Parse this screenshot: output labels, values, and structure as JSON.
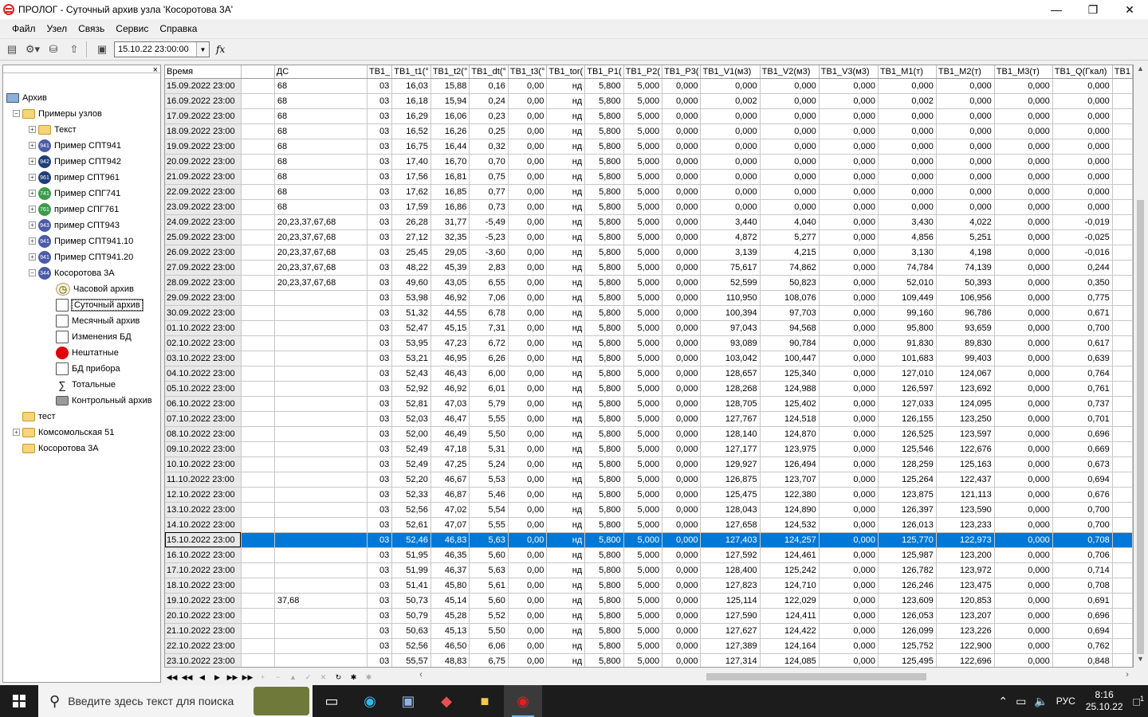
{
  "window": {
    "title": "ПРОЛОГ - Суточный архив узла 'Косоротова 3А'"
  },
  "menu": [
    "Файл",
    "Узел",
    "Связь",
    "Сервис",
    "Справка"
  ],
  "toolbar": {
    "date_value": "15.10.22 23:00:00",
    "fx_label": "fx"
  },
  "tree": [
    {
      "label": "Архив",
      "icon": "pc",
      "level": 0
    },
    {
      "label": "Примеры узлов",
      "icon": "folder",
      "level": 1,
      "exp": "-"
    },
    {
      "label": "Текст",
      "icon": "folder",
      "level": 2,
      "exp": "+"
    },
    {
      "label": "Пример СПТ941",
      "icon": "dev",
      "badge": "941",
      "level": 2,
      "exp": "+"
    },
    {
      "label": "Пример СПТ942",
      "icon": "devb",
      "badge": "942",
      "level": 2,
      "exp": "+"
    },
    {
      "label": "пример СПТ961",
      "icon": "devb",
      "badge": "961",
      "level": 2,
      "exp": "+"
    },
    {
      "label": "Пример СПГ741",
      "icon": "devg",
      "badge": "741",
      "level": 2,
      "exp": "+"
    },
    {
      "label": "пример СПГ761",
      "icon": "devg",
      "badge": "761",
      "level": 2,
      "exp": "+"
    },
    {
      "label": "пример СПТ943",
      "icon": "dev",
      "badge": "943",
      "level": 2,
      "exp": "+"
    },
    {
      "label": "Пример СПТ941.10",
      "icon": "dev",
      "badge": "941",
      "level": 2,
      "exp": "+"
    },
    {
      "label": "Пример СПТ941.20",
      "icon": "dev",
      "badge": "941",
      "level": 2,
      "exp": "+"
    },
    {
      "label": "Косоротова 3А",
      "icon": "dev",
      "badge": "344",
      "level": 2,
      "exp": "-"
    },
    {
      "label": "Часовой архив",
      "icon": "clock",
      "level": 3
    },
    {
      "label": "Суточный архив",
      "icon": "doc",
      "level": 3,
      "selected": true
    },
    {
      "label": "Месячный архив",
      "icon": "doc",
      "level": 3
    },
    {
      "label": "Изменения БД",
      "icon": "doc",
      "level": 3
    },
    {
      "label": "Нештатные",
      "icon": "red",
      "level": 3
    },
    {
      "label": "БД прибора",
      "icon": "doc",
      "level": 3
    },
    {
      "label": "Тотальные",
      "icon": "sum",
      "level": 3
    },
    {
      "label": "Контрольный архив",
      "icon": "chip",
      "level": 3
    },
    {
      "label": "тест",
      "icon": "folder",
      "level": 1
    },
    {
      "label": "Комсомольская 51",
      "icon": "folder",
      "level": 1,
      "exp": "+"
    },
    {
      "label": "Косоротова 3А",
      "icon": "folder",
      "level": 1
    }
  ],
  "table": {
    "columns": [
      "Время",
      "",
      "ДС",
      "ТВ1_",
      "ТВ1_t1(°",
      "ТВ1_t2(°",
      "ТВ1_dt(°",
      "ТВ1_t3(°",
      "ТВ1_tor(",
      "ТВ1_P1(",
      "ТВ1_P2(",
      "ТВ1_P3(",
      "ТВ1_V1(м3)",
      "ТВ1_V2(м3)",
      "ТВ1_V3(м3)",
      "ТВ1_M1(т)",
      "ТВ1_M2(т)",
      "ТВ1_M3(т)",
      "ТВ1_Q(Гкал)",
      "ТВ1"
    ],
    "selected_index": 30,
    "rows": [
      [
        "15.09.2022 23:00",
        "",
        "68",
        "03",
        "16,03",
        "15,88",
        "0,16",
        "0,00",
        "нд",
        "5,800",
        "5,000",
        "0,000",
        "0,000",
        "0,000",
        "0,000",
        "0,000",
        "0,000",
        "0,000",
        "0,000",
        ""
      ],
      [
        "16.09.2022 23:00",
        "",
        "68",
        "03",
        "16,18",
        "15,94",
        "0,24",
        "0,00",
        "нд",
        "5,800",
        "5,000",
        "0,000",
        "0,002",
        "0,000",
        "0,000",
        "0,002",
        "0,000",
        "0,000",
        "0,000",
        ""
      ],
      [
        "17.09.2022 23:00",
        "",
        "68",
        "03",
        "16,29",
        "16,06",
        "0,23",
        "0,00",
        "нд",
        "5,800",
        "5,000",
        "0,000",
        "0,000",
        "0,000",
        "0,000",
        "0,000",
        "0,000",
        "0,000",
        "0,000",
        ""
      ],
      [
        "18.09.2022 23:00",
        "",
        "68",
        "03",
        "16,52",
        "16,26",
        "0,25",
        "0,00",
        "нд",
        "5,800",
        "5,000",
        "0,000",
        "0,000",
        "0,000",
        "0,000",
        "0,000",
        "0,000",
        "0,000",
        "0,000",
        ""
      ],
      [
        "19.09.2022 23:00",
        "",
        "68",
        "03",
        "16,75",
        "16,44",
        "0,32",
        "0,00",
        "нд",
        "5,800",
        "5,000",
        "0,000",
        "0,000",
        "0,000",
        "0,000",
        "0,000",
        "0,000",
        "0,000",
        "0,000",
        ""
      ],
      [
        "20.09.2022 23:00",
        "",
        "68",
        "03",
        "17,40",
        "16,70",
        "0,70",
        "0,00",
        "нд",
        "5,800",
        "5,000",
        "0,000",
        "0,000",
        "0,000",
        "0,000",
        "0,000",
        "0,000",
        "0,000",
        "0,000",
        ""
      ],
      [
        "21.09.2022 23:00",
        "",
        "68",
        "03",
        "17,56",
        "16,81",
        "0,75",
        "0,00",
        "нд",
        "5,800",
        "5,000",
        "0,000",
        "0,000",
        "0,000",
        "0,000",
        "0,000",
        "0,000",
        "0,000",
        "0,000",
        ""
      ],
      [
        "22.09.2022 23:00",
        "",
        "68",
        "03",
        "17,62",
        "16,85",
        "0,77",
        "0,00",
        "нд",
        "5,800",
        "5,000",
        "0,000",
        "0,000",
        "0,000",
        "0,000",
        "0,000",
        "0,000",
        "0,000",
        "0,000",
        ""
      ],
      [
        "23.09.2022 23:00",
        "",
        "68",
        "03",
        "17,59",
        "16,86",
        "0,73",
        "0,00",
        "нд",
        "5,800",
        "5,000",
        "0,000",
        "0,000",
        "0,000",
        "0,000",
        "0,000",
        "0,000",
        "0,000",
        "0,000",
        ""
      ],
      [
        "24.09.2022 23:00",
        "",
        "20,23,37,67,68",
        "03",
        "26,28",
        "31,77",
        "-5,49",
        "0,00",
        "нд",
        "5,800",
        "5,000",
        "0,000",
        "3,440",
        "4,040",
        "0,000",
        "3,430",
        "4,022",
        "0,000",
        "-0,019",
        ""
      ],
      [
        "25.09.2022 23:00",
        "",
        "20,23,37,67,68",
        "03",
        "27,12",
        "32,35",
        "-5,23",
        "0,00",
        "нд",
        "5,800",
        "5,000",
        "0,000",
        "4,872",
        "5,277",
        "0,000",
        "4,856",
        "5,251",
        "0,000",
        "-0,025",
        ""
      ],
      [
        "26.09.2022 23:00",
        "",
        "20,23,37,67,68",
        "03",
        "25,45",
        "29,05",
        "-3,60",
        "0,00",
        "нд",
        "5,800",
        "5,000",
        "0,000",
        "3,139",
        "4,215",
        "0,000",
        "3,130",
        "4,198",
        "0,000",
        "-0,016",
        ""
      ],
      [
        "27.09.2022 23:00",
        "",
        "20,23,37,67,68",
        "03",
        "48,22",
        "45,39",
        "2,83",
        "0,00",
        "нд",
        "5,800",
        "5,000",
        "0,000",
        "75,617",
        "74,862",
        "0,000",
        "74,784",
        "74,139",
        "0,000",
        "0,244",
        ""
      ],
      [
        "28.09.2022 23:00",
        "",
        "20,23,37,67,68",
        "03",
        "49,60",
        "43,05",
        "6,55",
        "0,00",
        "нд",
        "5,800",
        "5,000",
        "0,000",
        "52,599",
        "50,823",
        "0,000",
        "52,010",
        "50,393",
        "0,000",
        "0,350",
        ""
      ],
      [
        "29.09.2022 23:00",
        "",
        "",
        "03",
        "53,98",
        "46,92",
        "7,06",
        "0,00",
        "нд",
        "5,800",
        "5,000",
        "0,000",
        "110,950",
        "108,076",
        "0,000",
        "109,449",
        "106,956",
        "0,000",
        "0,775",
        ""
      ],
      [
        "30.09.2022 23:00",
        "",
        "",
        "03",
        "51,32",
        "44,55",
        "6,78",
        "0,00",
        "нд",
        "5,800",
        "5,000",
        "0,000",
        "100,394",
        "97,703",
        "0,000",
        "99,160",
        "96,786",
        "0,000",
        "0,671",
        ""
      ],
      [
        "01.10.2022 23:00",
        "",
        "",
        "03",
        "52,47",
        "45,15",
        "7,31",
        "0,00",
        "нд",
        "5,800",
        "5,000",
        "0,000",
        "97,043",
        "94,568",
        "0,000",
        "95,800",
        "93,659",
        "0,000",
        "0,700",
        ""
      ],
      [
        "02.10.2022 23:00",
        "",
        "",
        "03",
        "53,95",
        "47,23",
        "6,72",
        "0,00",
        "нд",
        "5,800",
        "5,000",
        "0,000",
        "93,089",
        "90,784",
        "0,000",
        "91,830",
        "89,830",
        "0,000",
        "0,617",
        ""
      ],
      [
        "03.10.2022 23:00",
        "",
        "",
        "03",
        "53,21",
        "46,95",
        "6,26",
        "0,00",
        "нд",
        "5,800",
        "5,000",
        "0,000",
        "103,042",
        "100,447",
        "0,000",
        "101,683",
        "99,403",
        "0,000",
        "0,639",
        ""
      ],
      [
        "04.10.2022 23:00",
        "",
        "",
        "03",
        "52,43",
        "46,43",
        "6,00",
        "0,00",
        "нд",
        "5,800",
        "5,000",
        "0,000",
        "128,657",
        "125,340",
        "0,000",
        "127,010",
        "124,067",
        "0,000",
        "0,764",
        ""
      ],
      [
        "05.10.2022 23:00",
        "",
        "",
        "03",
        "52,92",
        "46,92",
        "6,01",
        "0,00",
        "нд",
        "5,800",
        "5,000",
        "0,000",
        "128,268",
        "124,988",
        "0,000",
        "126,597",
        "123,692",
        "0,000",
        "0,761",
        ""
      ],
      [
        "06.10.2022 23:00",
        "",
        "",
        "03",
        "52,81",
        "47,03",
        "5,79",
        "0,00",
        "нд",
        "5,800",
        "5,000",
        "0,000",
        "128,705",
        "125,402",
        "0,000",
        "127,033",
        "124,095",
        "0,000",
        "0,737",
        ""
      ],
      [
        "07.10.2022 23:00",
        "",
        "",
        "03",
        "52,03",
        "46,47",
        "5,55",
        "0,00",
        "нд",
        "5,800",
        "5,000",
        "0,000",
        "127,767",
        "124,518",
        "0,000",
        "126,155",
        "123,250",
        "0,000",
        "0,701",
        ""
      ],
      [
        "08.10.2022 23:00",
        "",
        "",
        "03",
        "52,00",
        "46,49",
        "5,50",
        "0,00",
        "нд",
        "5,800",
        "5,000",
        "0,000",
        "128,140",
        "124,870",
        "0,000",
        "126,525",
        "123,597",
        "0,000",
        "0,696",
        ""
      ],
      [
        "09.10.2022 23:00",
        "",
        "",
        "03",
        "52,49",
        "47,18",
        "5,31",
        "0,00",
        "нд",
        "5,800",
        "5,000",
        "0,000",
        "127,177",
        "123,975",
        "0,000",
        "125,546",
        "122,676",
        "0,000",
        "0,669",
        ""
      ],
      [
        "10.10.2022 23:00",
        "",
        "",
        "03",
        "52,49",
        "47,25",
        "5,24",
        "0,00",
        "нд",
        "5,800",
        "5,000",
        "0,000",
        "129,927",
        "126,494",
        "0,000",
        "128,259",
        "125,163",
        "0,000",
        "0,673",
        ""
      ],
      [
        "11.10.2022 23:00",
        "",
        "",
        "03",
        "52,20",
        "46,67",
        "5,53",
        "0,00",
        "нд",
        "5,800",
        "5,000",
        "0,000",
        "126,875",
        "123,707",
        "0,000",
        "125,264",
        "122,437",
        "0,000",
        "0,694",
        ""
      ],
      [
        "12.10.2022 23:00",
        "",
        "",
        "03",
        "52,33",
        "46,87",
        "5,46",
        "0,00",
        "нд",
        "5,800",
        "5,000",
        "0,000",
        "125,475",
        "122,380",
        "0,000",
        "123,875",
        "121,113",
        "0,000",
        "0,676",
        ""
      ],
      [
        "13.10.2022 23:00",
        "",
        "",
        "03",
        "52,56",
        "47,02",
        "5,54",
        "0,00",
        "нд",
        "5,800",
        "5,000",
        "0,000",
        "128,043",
        "124,890",
        "0,000",
        "126,397",
        "123,590",
        "0,000",
        "0,700",
        ""
      ],
      [
        "14.10.2022 23:00",
        "",
        "",
        "03",
        "52,61",
        "47,07",
        "5,55",
        "0,00",
        "нд",
        "5,800",
        "5,000",
        "0,000",
        "127,658",
        "124,532",
        "0,000",
        "126,013",
        "123,233",
        "0,000",
        "0,700",
        ""
      ],
      [
        "15.10.2022 23:00",
        "",
        "",
        "03",
        "52,46",
        "46,83",
        "5,63",
        "0,00",
        "нд",
        "5,800",
        "5,000",
        "0,000",
        "127,403",
        "124,257",
        "0,000",
        "125,770",
        "122,973",
        "0,000",
        "0,708",
        ""
      ],
      [
        "16.10.2022 23:00",
        "",
        "",
        "03",
        "51,95",
        "46,35",
        "5,60",
        "0,00",
        "нд",
        "5,800",
        "5,000",
        "0,000",
        "127,592",
        "124,461",
        "0,000",
        "125,987",
        "123,200",
        "0,000",
        "0,706",
        ""
      ],
      [
        "17.10.2022 23:00",
        "",
        "",
        "03",
        "51,99",
        "46,37",
        "5,63",
        "0,00",
        "нд",
        "5,800",
        "5,000",
        "0,000",
        "128,400",
        "125,242",
        "0,000",
        "126,782",
        "123,972",
        "0,000",
        "0,714",
        ""
      ],
      [
        "18.10.2022 23:00",
        "",
        "",
        "03",
        "51,41",
        "45,80",
        "5,61",
        "0,00",
        "нд",
        "5,800",
        "5,000",
        "0,000",
        "127,823",
        "124,710",
        "0,000",
        "126,246",
        "123,475",
        "0,000",
        "0,708",
        ""
      ],
      [
        "19.10.2022 23:00",
        "",
        "37,68",
        "03",
        "50,73",
        "45,14",
        "5,60",
        "0,00",
        "нд",
        "5,800",
        "5,000",
        "0,000",
        "125,114",
        "122,029",
        "0,000",
        "123,609",
        "120,853",
        "0,000",
        "0,691",
        ""
      ],
      [
        "20.10.2022 23:00",
        "",
        "",
        "03",
        "50,79",
        "45,28",
        "5,52",
        "0,00",
        "нд",
        "5,800",
        "5,000",
        "0,000",
        "127,590",
        "124,411",
        "0,000",
        "126,053",
        "123,207",
        "0,000",
        "0,696",
        ""
      ],
      [
        "21.10.2022 23:00",
        "",
        "",
        "03",
        "50,63",
        "45,13",
        "5,50",
        "0,00",
        "нд",
        "5,800",
        "5,000",
        "0,000",
        "127,627",
        "124,422",
        "0,000",
        "126,099",
        "123,226",
        "0,000",
        "0,694",
        ""
      ],
      [
        "22.10.2022 23:00",
        "",
        "",
        "03",
        "52,56",
        "46,50",
        "6,06",
        "0,00",
        "нд",
        "5,800",
        "5,000",
        "0,000",
        "127,389",
        "124,164",
        "0,000",
        "125,752",
        "122,900",
        "0,000",
        "0,762",
        ""
      ],
      [
        "23.10.2022 23:00",
        "",
        "",
        "03",
        "55,57",
        "48,83",
        "6,75",
        "0,00",
        "нд",
        "5,800",
        "5,000",
        "0,000",
        "127,314",
        "124,085",
        "0,000",
        "125,495",
        "122,696",
        "0,000",
        "0,848",
        ""
      ]
    ]
  },
  "taskbar": {
    "search_placeholder": "Введите здесь текст для поиска",
    "language": "РУС",
    "time": "8:16",
    "date": "25.10.22",
    "notif_count": "1"
  }
}
